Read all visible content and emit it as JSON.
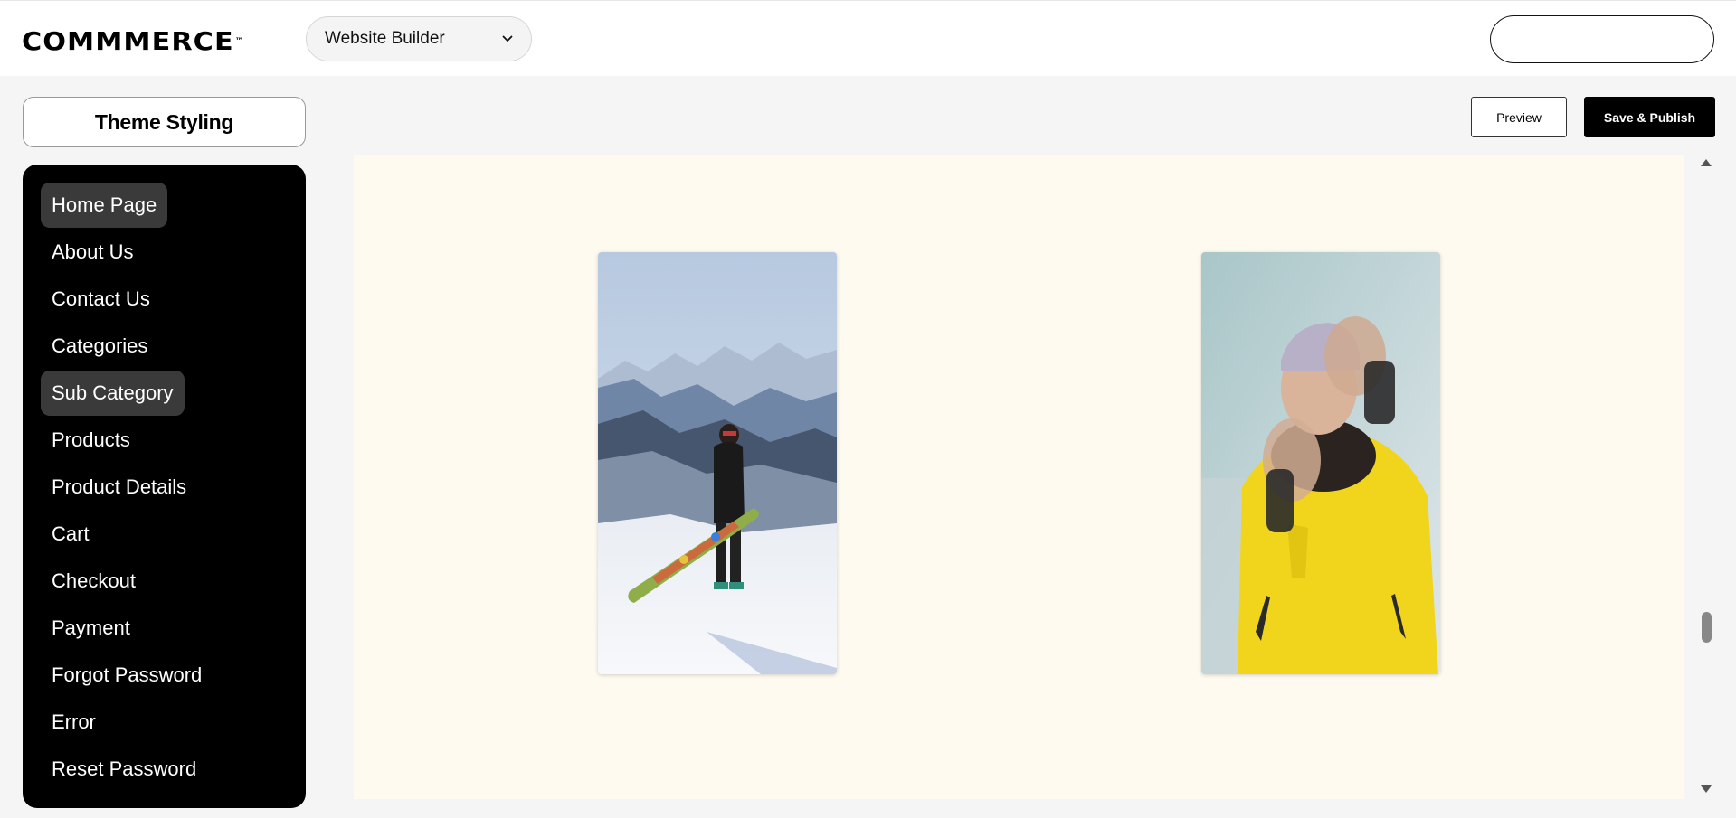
{
  "header": {
    "logo_text": "COMMMERCE",
    "logo_mark": "™",
    "builder_select": {
      "value": "Website Builder",
      "icon": "chevron-down-icon"
    }
  },
  "left_panel": {
    "theme_button_label": "Theme Styling",
    "nav": [
      {
        "label": "Home Page",
        "highlighted": true
      },
      {
        "label": "About Us",
        "highlighted": false
      },
      {
        "label": "Contact Us",
        "highlighted": false
      },
      {
        "label": "Categories",
        "highlighted": false
      },
      {
        "label": "Sub Category",
        "highlighted": true
      },
      {
        "label": "Products",
        "highlighted": false
      },
      {
        "label": "Product Details",
        "highlighted": false
      },
      {
        "label": "Cart",
        "highlighted": false
      },
      {
        "label": "Checkout",
        "highlighted": false
      },
      {
        "label": "Payment",
        "highlighted": false
      },
      {
        "label": "Forgot Password",
        "highlighted": false
      },
      {
        "label": "Error",
        "highlighted": false
      },
      {
        "label": "Reset Password",
        "highlighted": false
      }
    ]
  },
  "actions": {
    "preview_label": "Preview",
    "publish_label": "Save & Publish"
  },
  "canvas": {
    "background_color": "#fefaf0",
    "images": [
      {
        "depicts": "snowboarder standing on a snowy mountain slope"
      },
      {
        "depicts": "woman in a yellow ski jacket waving at the camera"
      }
    ]
  },
  "colors": {
    "sidebar_bg": "#000000",
    "nav_highlight": "#3a3a3a",
    "primary_button": "#000000"
  }
}
